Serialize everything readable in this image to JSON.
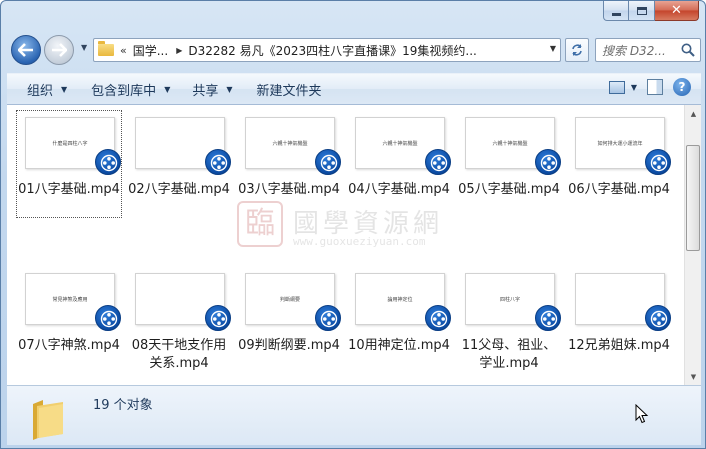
{
  "window": {
    "minimize_label": "–",
    "close_label": "✕"
  },
  "nav": {
    "address_prefix": "«",
    "crumbs": [
      "国学...",
      "D32282 易凡《2023四柱八字直播课》19集视频约..."
    ],
    "search_placeholder": "搜索 D32..."
  },
  "toolbar": {
    "organize": "组织",
    "include_in_library": "包含到库中",
    "share": "共享",
    "new_folder": "新建文件夹"
  },
  "files": [
    {
      "name": "01八字基础.mp4",
      "thumb_text": "什麼是四柱八字",
      "selected": true
    },
    {
      "name": "02八字基础.mp4",
      "thumb_text": ""
    },
    {
      "name": "03八字基础.mp4",
      "thumb_text": "六親十神氣機盤"
    },
    {
      "name": "04八字基础.mp4",
      "thumb_text": "六親十神氣機盤"
    },
    {
      "name": "05八字基础.mp4",
      "thumb_text": "六親十神氣機盤"
    },
    {
      "name": "06八字基础.mp4",
      "thumb_text": "如何排大運小運流年"
    },
    {
      "name": "07八字神煞.mp4",
      "thumb_text": "常見神煞及應用"
    },
    {
      "name": "08天干地支作用关系.mp4",
      "thumb_text": ""
    },
    {
      "name": "09判断纲要.mp4",
      "thumb_text": "判斷綱要"
    },
    {
      "name": "10用神定位.mp4",
      "thumb_text": "論用神定位"
    },
    {
      "name": "11父母、祖业、学业.mp4",
      "thumb_text": "四柱八字"
    },
    {
      "name": "12兄弟姐妹.mp4",
      "thumb_text": ""
    }
  ],
  "watermark": {
    "logo": "臨",
    "cn": "國學資源網",
    "url": "www.guoxueziyuan.com"
  },
  "status": {
    "count": "19 个对象"
  }
}
